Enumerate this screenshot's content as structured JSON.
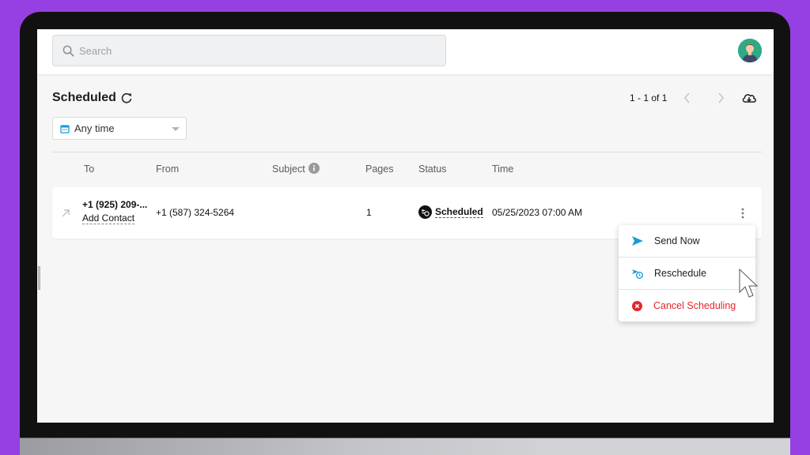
{
  "search": {
    "placeholder": "Search",
    "value": ""
  },
  "header": {
    "title": "Scheduled",
    "pagination": "1 - 1 of 1"
  },
  "filter": {
    "selected": "Any time"
  },
  "table": {
    "columns": [
      "To",
      "From",
      "Subject",
      "Pages",
      "Status",
      "Time"
    ],
    "rows": [
      {
        "to": "+1 (925) 209-...",
        "to_action": "Add Contact",
        "from": "+1 (587) 324-5264",
        "subject": "",
        "pages": "1",
        "status": "Scheduled",
        "time": "05/25/2023 07:00 AM"
      }
    ]
  },
  "menu": {
    "items": [
      {
        "label": "Send Now",
        "icon": "send-icon"
      },
      {
        "label": "Reschedule",
        "icon": "reschedule-icon"
      },
      {
        "label": "Cancel Scheduling",
        "icon": "cancel-icon"
      }
    ]
  },
  "colors": {
    "frame": "#9640e3",
    "accent_blue": "#1a9bd7",
    "danger": "#e4262c",
    "avatar_bg": "#2eaa84"
  }
}
